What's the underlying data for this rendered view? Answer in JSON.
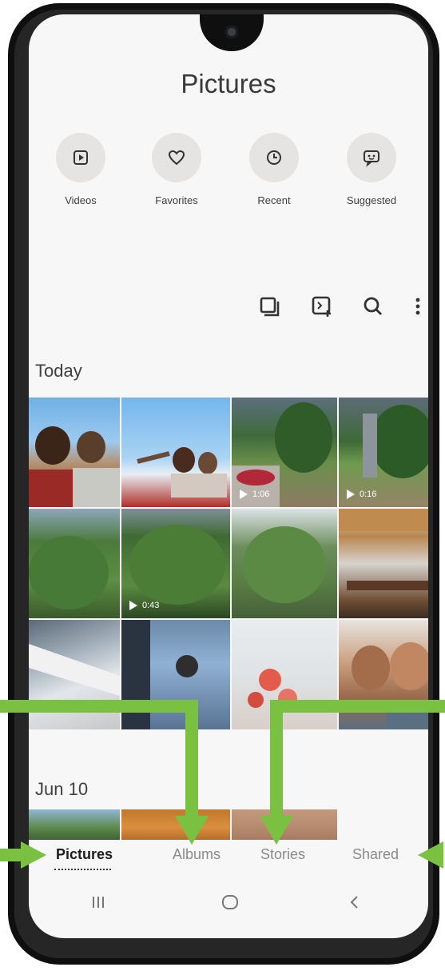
{
  "header": {
    "title": "Pictures"
  },
  "quick_actions": [
    {
      "label": "Videos",
      "icon": "video-icon"
    },
    {
      "label": "Favorites",
      "icon": "heart-icon"
    },
    {
      "label": "Recent",
      "icon": "clock-icon"
    },
    {
      "label": "Suggested",
      "icon": "suggested-icon"
    }
  ],
  "toolbar": [
    "select-icon",
    "create-icon",
    "search-icon",
    "more-options-icon"
  ],
  "sections": [
    {
      "title": "Today"
    },
    {
      "title": "Jun 10"
    }
  ],
  "video_durations": {
    "t1": "1:06",
    "t2": "0:16",
    "t3": "0:43"
  },
  "tabs": [
    {
      "label": "Pictures",
      "active": true
    },
    {
      "label": "Albums",
      "active": false
    },
    {
      "label": "Stories",
      "active": false
    },
    {
      "label": "Shared",
      "active": false
    }
  ],
  "nav": [
    "recent-apps-icon",
    "home-icon",
    "back-icon"
  ],
  "colors": {
    "arrow": "#7ac142",
    "screen_bg": "#f7f7f7",
    "quick_circle": "#e5e4e3"
  }
}
